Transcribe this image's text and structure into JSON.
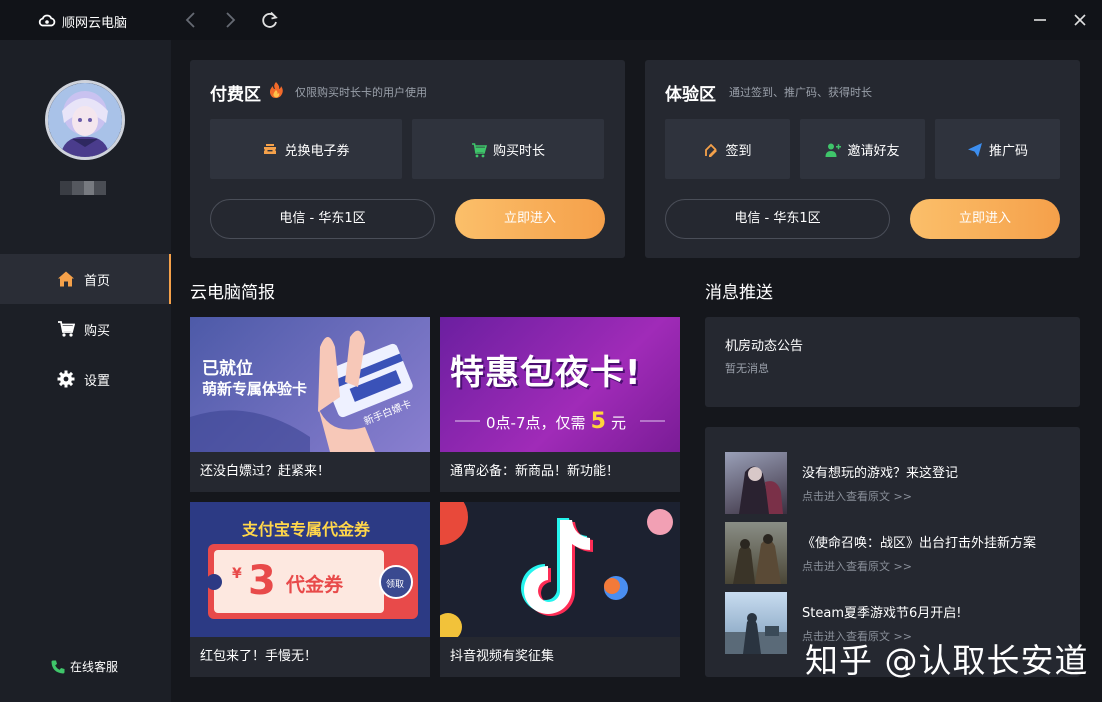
{
  "app": {
    "title": "顺网云电脑"
  },
  "sidebar": {
    "username": "",
    "items": [
      {
        "label": "首页",
        "icon": "home-icon",
        "active": true
      },
      {
        "label": "购买",
        "icon": "cart-icon",
        "active": false
      },
      {
        "label": "设置",
        "icon": "gear-icon",
        "active": false
      }
    ],
    "support_label": "在线客服"
  },
  "paid_zone": {
    "title": "付费区",
    "subtitle": "仅限购买时长卡的用户使用",
    "buttons": [
      {
        "label": "兑换电子券",
        "icon": "coupon-icon"
      },
      {
        "label": "购买时长",
        "icon": "cart-icon"
      }
    ],
    "server": "电信 - 华东1区",
    "enter_label": "立即进入"
  },
  "trial_zone": {
    "title": "体验区",
    "subtitle": "通过签到、推广码、获得时长",
    "buttons": [
      {
        "label": "签到",
        "icon": "signin-icon"
      },
      {
        "label": "邀请好友",
        "icon": "add-user-icon"
      },
      {
        "label": "推广码",
        "icon": "send-icon"
      }
    ],
    "server": "电信 - 华东1区",
    "enter_label": "立即进入"
  },
  "news": {
    "title": "云电脑简报",
    "cards": [
      {
        "caption": "还没白嫖过？赶紧来！",
        "banner_line1": "已就位",
        "banner_line2": "萌新专属体验卡",
        "banner_card_text": "新手白嫖卡"
      },
      {
        "caption": "通宵必备：新商品！新功能！",
        "banner_line1": "特惠包夜卡!",
        "banner_line2": "0点-7点，仅需",
        "banner_price": "5",
        "banner_unit": "元"
      },
      {
        "caption": "红包来了！手慢无！",
        "banner_line1": "支付宝专属代金券",
        "banner_amount": "3",
        "banner_currency": "¥",
        "banner_coupon": "代金券",
        "banner_claim": "领取"
      },
      {
        "caption": "抖音视频有奖征集"
      }
    ]
  },
  "messages": {
    "title": "消息推送",
    "notice_title": "机房动态公告",
    "notice_body": "暂无消息",
    "feed": [
      {
        "title": "没有想玩的游戏？来这登记",
        "link": "点击进入查看原文 >>"
      },
      {
        "title": "《使命召唤：战区》出台打击外挂新方案",
        "link": "点击进入查看原文 >>"
      },
      {
        "title": "Steam夏季游戏节6月开启!",
        "link": "点击进入查看原文 >>"
      }
    ]
  },
  "watermark": "知乎 @认取长安道",
  "colors": {
    "accent": "#f5a14a",
    "panel": "#252830",
    "sidebar": "#1c1f26",
    "background": "#15171c"
  }
}
